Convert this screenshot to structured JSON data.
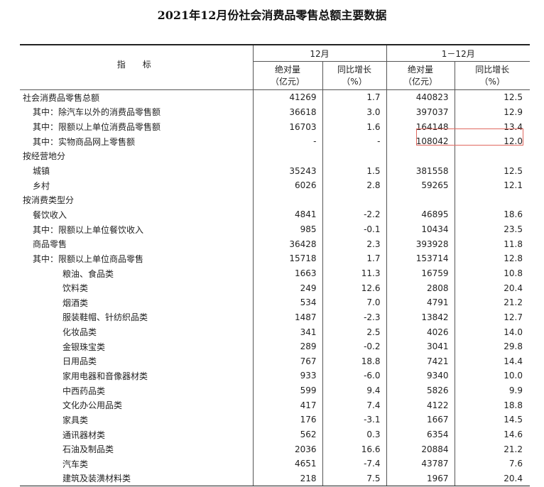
{
  "title": "2021年12月份社会消费品零售总额主要数据",
  "header": {
    "indicator": "指　标",
    "group_month": "12月",
    "group_ytd": "1－12月",
    "abs_label": "绝对量\n（亿元）",
    "yoy_label": "同比增长\n（%）"
  },
  "rows": [
    {
      "label": "社会消费品零售总额",
      "indent": 0,
      "m_abs": "41269",
      "m_yoy": "1.7",
      "y_abs": "440823",
      "y_yoy": "12.5"
    },
    {
      "label": "其中：除汽车以外的消费品零售额",
      "indent": 1,
      "m_abs": "36618",
      "m_yoy": "3.0",
      "y_abs": "397037",
      "y_yoy": "12.9"
    },
    {
      "label": "其中：限额以上单位消费品零售额",
      "indent": 1,
      "m_abs": "16703",
      "m_yoy": "1.6",
      "y_abs": "164148",
      "y_yoy": "13.4"
    },
    {
      "label": "其中：实物商品网上零售额",
      "indent": 1,
      "m_abs": "-",
      "m_yoy": "-",
      "y_abs": "108042",
      "y_yoy": "12.0",
      "highlight": true
    },
    {
      "label": "按经营地分",
      "indent": 0,
      "m_abs": "",
      "m_yoy": "",
      "y_abs": "",
      "y_yoy": ""
    },
    {
      "label": "城镇",
      "indent": 1,
      "m_abs": "35243",
      "m_yoy": "1.5",
      "y_abs": "381558",
      "y_yoy": "12.5"
    },
    {
      "label": "乡村",
      "indent": 1,
      "m_abs": "6026",
      "m_yoy": "2.8",
      "y_abs": "59265",
      "y_yoy": "12.1"
    },
    {
      "label": "按消费类型分",
      "indent": 0,
      "m_abs": "",
      "m_yoy": "",
      "y_abs": "",
      "y_yoy": ""
    },
    {
      "label": "餐饮收入",
      "indent": 1,
      "m_abs": "4841",
      "m_yoy": "-2.2",
      "y_abs": "46895",
      "y_yoy": "18.6"
    },
    {
      "label": "其中：限额以上单位餐饮收入",
      "indent": 1.5,
      "m_abs": "985",
      "m_yoy": "-0.1",
      "y_abs": "10434",
      "y_yoy": "23.5"
    },
    {
      "label": "商品零售",
      "indent": 1,
      "m_abs": "36428",
      "m_yoy": "2.3",
      "y_abs": "393928",
      "y_yoy": "11.8"
    },
    {
      "label": "其中：限额以上单位商品零售",
      "indent": 1.5,
      "m_abs": "15718",
      "m_yoy": "1.7",
      "y_abs": "153714",
      "y_yoy": "12.8"
    },
    {
      "label": "粮油、食品类",
      "indent": 2,
      "m_abs": "1663",
      "m_yoy": "11.3",
      "y_abs": "16759",
      "y_yoy": "10.8"
    },
    {
      "label": "饮料类",
      "indent": 2,
      "m_abs": "249",
      "m_yoy": "12.6",
      "y_abs": "2808",
      "y_yoy": "20.4"
    },
    {
      "label": "烟酒类",
      "indent": 2,
      "m_abs": "534",
      "m_yoy": "7.0",
      "y_abs": "4791",
      "y_yoy": "21.2"
    },
    {
      "label": "服装鞋帽、针纺织品类",
      "indent": 2,
      "m_abs": "1487",
      "m_yoy": "-2.3",
      "y_abs": "13842",
      "y_yoy": "12.7"
    },
    {
      "label": "化妆品类",
      "indent": 2,
      "m_abs": "341",
      "m_yoy": "2.5",
      "y_abs": "4026",
      "y_yoy": "14.0"
    },
    {
      "label": "金银珠宝类",
      "indent": 2,
      "m_abs": "289",
      "m_yoy": "-0.2",
      "y_abs": "3041",
      "y_yoy": "29.8"
    },
    {
      "label": "日用品类",
      "indent": 2,
      "m_abs": "767",
      "m_yoy": "18.8",
      "y_abs": "7421",
      "y_yoy": "14.4"
    },
    {
      "label": "家用电器和音像器材类",
      "indent": 2,
      "m_abs": "933",
      "m_yoy": "-6.0",
      "y_abs": "9340",
      "y_yoy": "10.0"
    },
    {
      "label": "中西药品类",
      "indent": 2,
      "m_abs": "599",
      "m_yoy": "9.4",
      "y_abs": "5826",
      "y_yoy": "9.9"
    },
    {
      "label": "文化办公用品类",
      "indent": 2,
      "m_abs": "417",
      "m_yoy": "7.4",
      "y_abs": "4122",
      "y_yoy": "18.8"
    },
    {
      "label": "家具类",
      "indent": 2,
      "m_abs": "176",
      "m_yoy": "-3.1",
      "y_abs": "1667",
      "y_yoy": "14.5"
    },
    {
      "label": "通讯器材类",
      "indent": 2,
      "m_abs": "562",
      "m_yoy": "0.3",
      "y_abs": "6354",
      "y_yoy": "14.6"
    },
    {
      "label": "石油及制品类",
      "indent": 2,
      "m_abs": "2036",
      "m_yoy": "16.6",
      "y_abs": "20884",
      "y_yoy": "21.2"
    },
    {
      "label": "汽车类",
      "indent": 2,
      "m_abs": "4651",
      "m_yoy": "-7.4",
      "y_abs": "43787",
      "y_yoy": "7.6"
    },
    {
      "label": "建筑及装潢材料类",
      "indent": 2,
      "m_abs": "218",
      "m_yoy": "7.5",
      "y_abs": "1967",
      "y_yoy": "20.4"
    }
  ],
  "colors": {
    "highlight_border": "#e0685f",
    "rule": "#222222"
  }
}
